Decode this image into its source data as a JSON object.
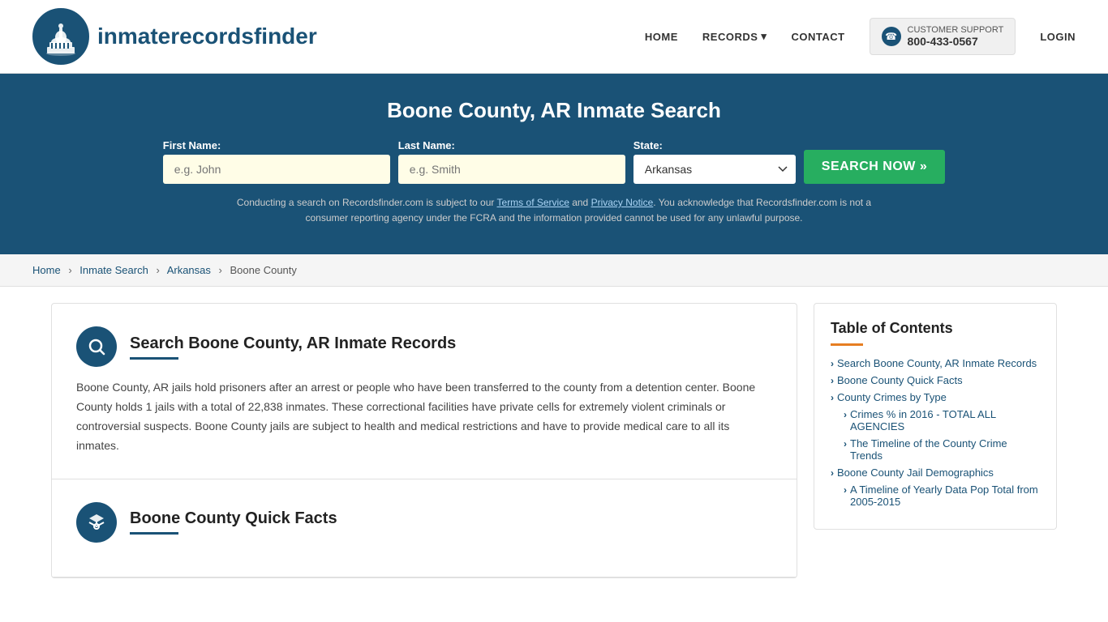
{
  "header": {
    "logo_text_normal": "inmaterecords",
    "logo_text_bold": "finder",
    "nav": {
      "home": "HOME",
      "records": "RECORDS",
      "contact": "CONTACT",
      "login": "LOGIN"
    },
    "support": {
      "label": "CUSTOMER SUPPORT",
      "phone": "800-433-0567"
    }
  },
  "hero": {
    "title": "Boone County, AR Inmate Search",
    "form": {
      "first_name_label": "First Name:",
      "first_name_placeholder": "e.g. John",
      "last_name_label": "Last Name:",
      "last_name_placeholder": "e.g. Smith",
      "state_label": "State:",
      "state_value": "Arkansas",
      "search_button": "SEARCH NOW »"
    },
    "disclaimer": "Conducting a search on Recordsfinder.com is subject to our Terms of Service and Privacy Notice. You acknowledge that Recordsfinder.com is not a consumer reporting agency under the FCRA and the information provided cannot be used for any unlawful purpose."
  },
  "breadcrumb": {
    "home": "Home",
    "inmate_search": "Inmate Search",
    "state": "Arkansas",
    "county": "Boone County"
  },
  "main_section": {
    "title": "Search Boone County, AR Inmate Records",
    "body": "Boone County, AR jails hold prisoners after an arrest or people who have been transferred to the county from a detention center. Boone County holds 1 jails with a total of 22,838 inmates. These correctional facilities have private cells for extremely violent criminals or controversial suspects. Boone County jails are subject to health and medical restrictions and have to provide medical care to all its inmates."
  },
  "quick_facts_section": {
    "title": "Boone County Quick Facts"
  },
  "toc": {
    "title": "Table of Contents",
    "items": [
      {
        "label": "Search Boone County, AR Inmate Records",
        "sub": false
      },
      {
        "label": "Boone County Quick Facts",
        "sub": false
      },
      {
        "label": "County Crimes by Type",
        "sub": false
      },
      {
        "label": "Crimes % in 2016 - TOTAL ALL AGENCIES",
        "sub": true
      },
      {
        "label": "The Timeline of the County Crime Trends",
        "sub": true
      },
      {
        "label": "Boone County Jail Demographics",
        "sub": false
      },
      {
        "label": "A Timeline of Yearly Data Pop Total from 2005-2015",
        "sub": true
      }
    ]
  }
}
